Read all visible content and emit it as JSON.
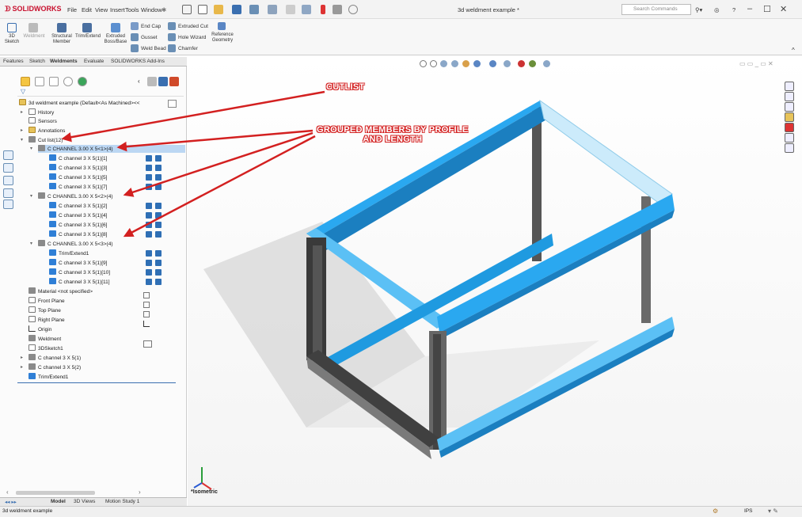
{
  "titlebar": {
    "logo": "SOLIDWORKS",
    "menus": [
      "File",
      "Edit",
      "View",
      "Insert",
      "Tools",
      "Window"
    ],
    "document_title": "3d weldment example *",
    "search_placeholder": "Search Commands"
  },
  "command_manager": {
    "big_buttons": [
      {
        "label": "3D\nSketch"
      },
      {
        "label": "Weldment"
      },
      {
        "label": "Structural\nMember"
      },
      {
        "label": "Trim/Extend"
      },
      {
        "label": "Extruded\nBoss/Base"
      }
    ],
    "col1": [
      "End Cap",
      "Gusset",
      "Weld Bead"
    ],
    "col2": [
      "Extruded Cut",
      "Hole Wizard",
      "Chamfer"
    ],
    "reference_geometry": "Reference\nGeometry"
  },
  "tabs": [
    "Features",
    "Sketch",
    "Weldments",
    "Evaluate",
    "SOLIDWORKS Add-Ins"
  ],
  "active_tab": "Weldments",
  "tree": {
    "root": "3d weldment example (Default<As Machined><<",
    "history": "History",
    "sensors": "Sensors",
    "annotations": "Annotations",
    "cutlist": "Cut list(12)",
    "groups": [
      {
        "label": "C CHANNEL 3.00 X 5<1>(4)",
        "items": [
          "C channel 3 X 5(1)[1]",
          "C channel 3 X 5(1)[3]",
          "C channel 3 X 5(1)[5]",
          "C channel 3 X 5(1)[7]"
        ]
      },
      {
        "label": "C CHANNEL 3.00 X 5<2>(4)",
        "items": [
          "C channel 3 X 5(1)[2]",
          "C channel 3 X 5(1)[4]",
          "C channel 3 X 5(1)[6]",
          "C channel 3 X 5(1)[8]"
        ]
      },
      {
        "label": "C CHANNEL 3.00 X 5<3>(4)",
        "items": [
          "Trim/Extend1",
          "C channel 3 X 5(1)[9]",
          "C channel 3 X 5(1)[10]",
          "C channel 3 X 5(1)[11]"
        ]
      }
    ],
    "material": "Material <not specified>",
    "front_plane": "Front Plane",
    "top_plane": "Top Plane",
    "right_plane": "Right Plane",
    "origin": "Origin",
    "weldment": "Weldment",
    "sketch": "3DSketch1",
    "feat1": "C channel 3 X 5(1)",
    "feat2": "C channel 3 X 5(2)",
    "feat3": "Trim/Extend1"
  },
  "bottom_tabs": [
    "Model",
    "3D Views",
    "Motion Study 1"
  ],
  "status": {
    "left": "3d weldment example",
    "units": "IPS"
  },
  "viewport": {
    "view_label": "*Isometric"
  },
  "annotations": {
    "cutlist": "CUTLIST",
    "grouped": "GROUPED MEMBERS BY PROFILE\nAND LENGTH"
  },
  "colors": {
    "accent_red": "#d32020",
    "highlight_blue": "#2aa8f0",
    "brand_red": "#c8102e"
  }
}
